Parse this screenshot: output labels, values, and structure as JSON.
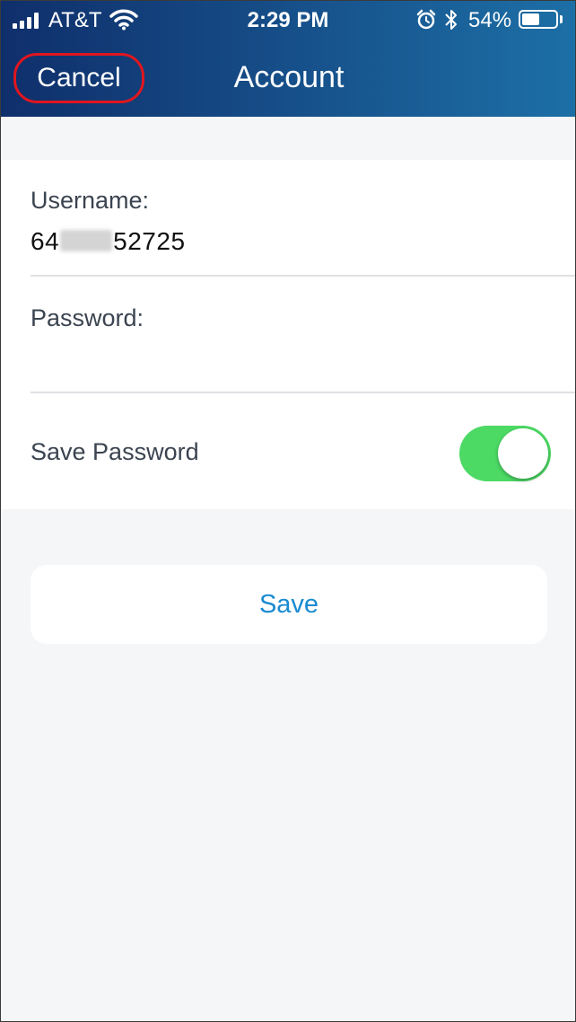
{
  "status_bar": {
    "carrier": "AT&T",
    "time": "2:29 PM",
    "battery_percent": "54%",
    "battery_level": 0.54,
    "icons": [
      "signal-icon",
      "wifi-icon",
      "alarm-icon",
      "bluetooth-icon",
      "battery-icon"
    ]
  },
  "nav": {
    "cancel_label": "Cancel",
    "title": "Account",
    "highlight_color": "#e0161f"
  },
  "form": {
    "username_label": "Username:",
    "username_value_prefix": "64",
    "username_value_suffix": "52725",
    "password_label": "Password:",
    "password_value": "",
    "save_password_label": "Save Password",
    "save_password_enabled": true
  },
  "actions": {
    "save_label": "Save",
    "accent_color": "#1a8bd0"
  },
  "colors": {
    "header_gradient_start": "#0f2f6b",
    "header_gradient_end": "#1d6fa6",
    "toggle_on": "#4cd964"
  }
}
